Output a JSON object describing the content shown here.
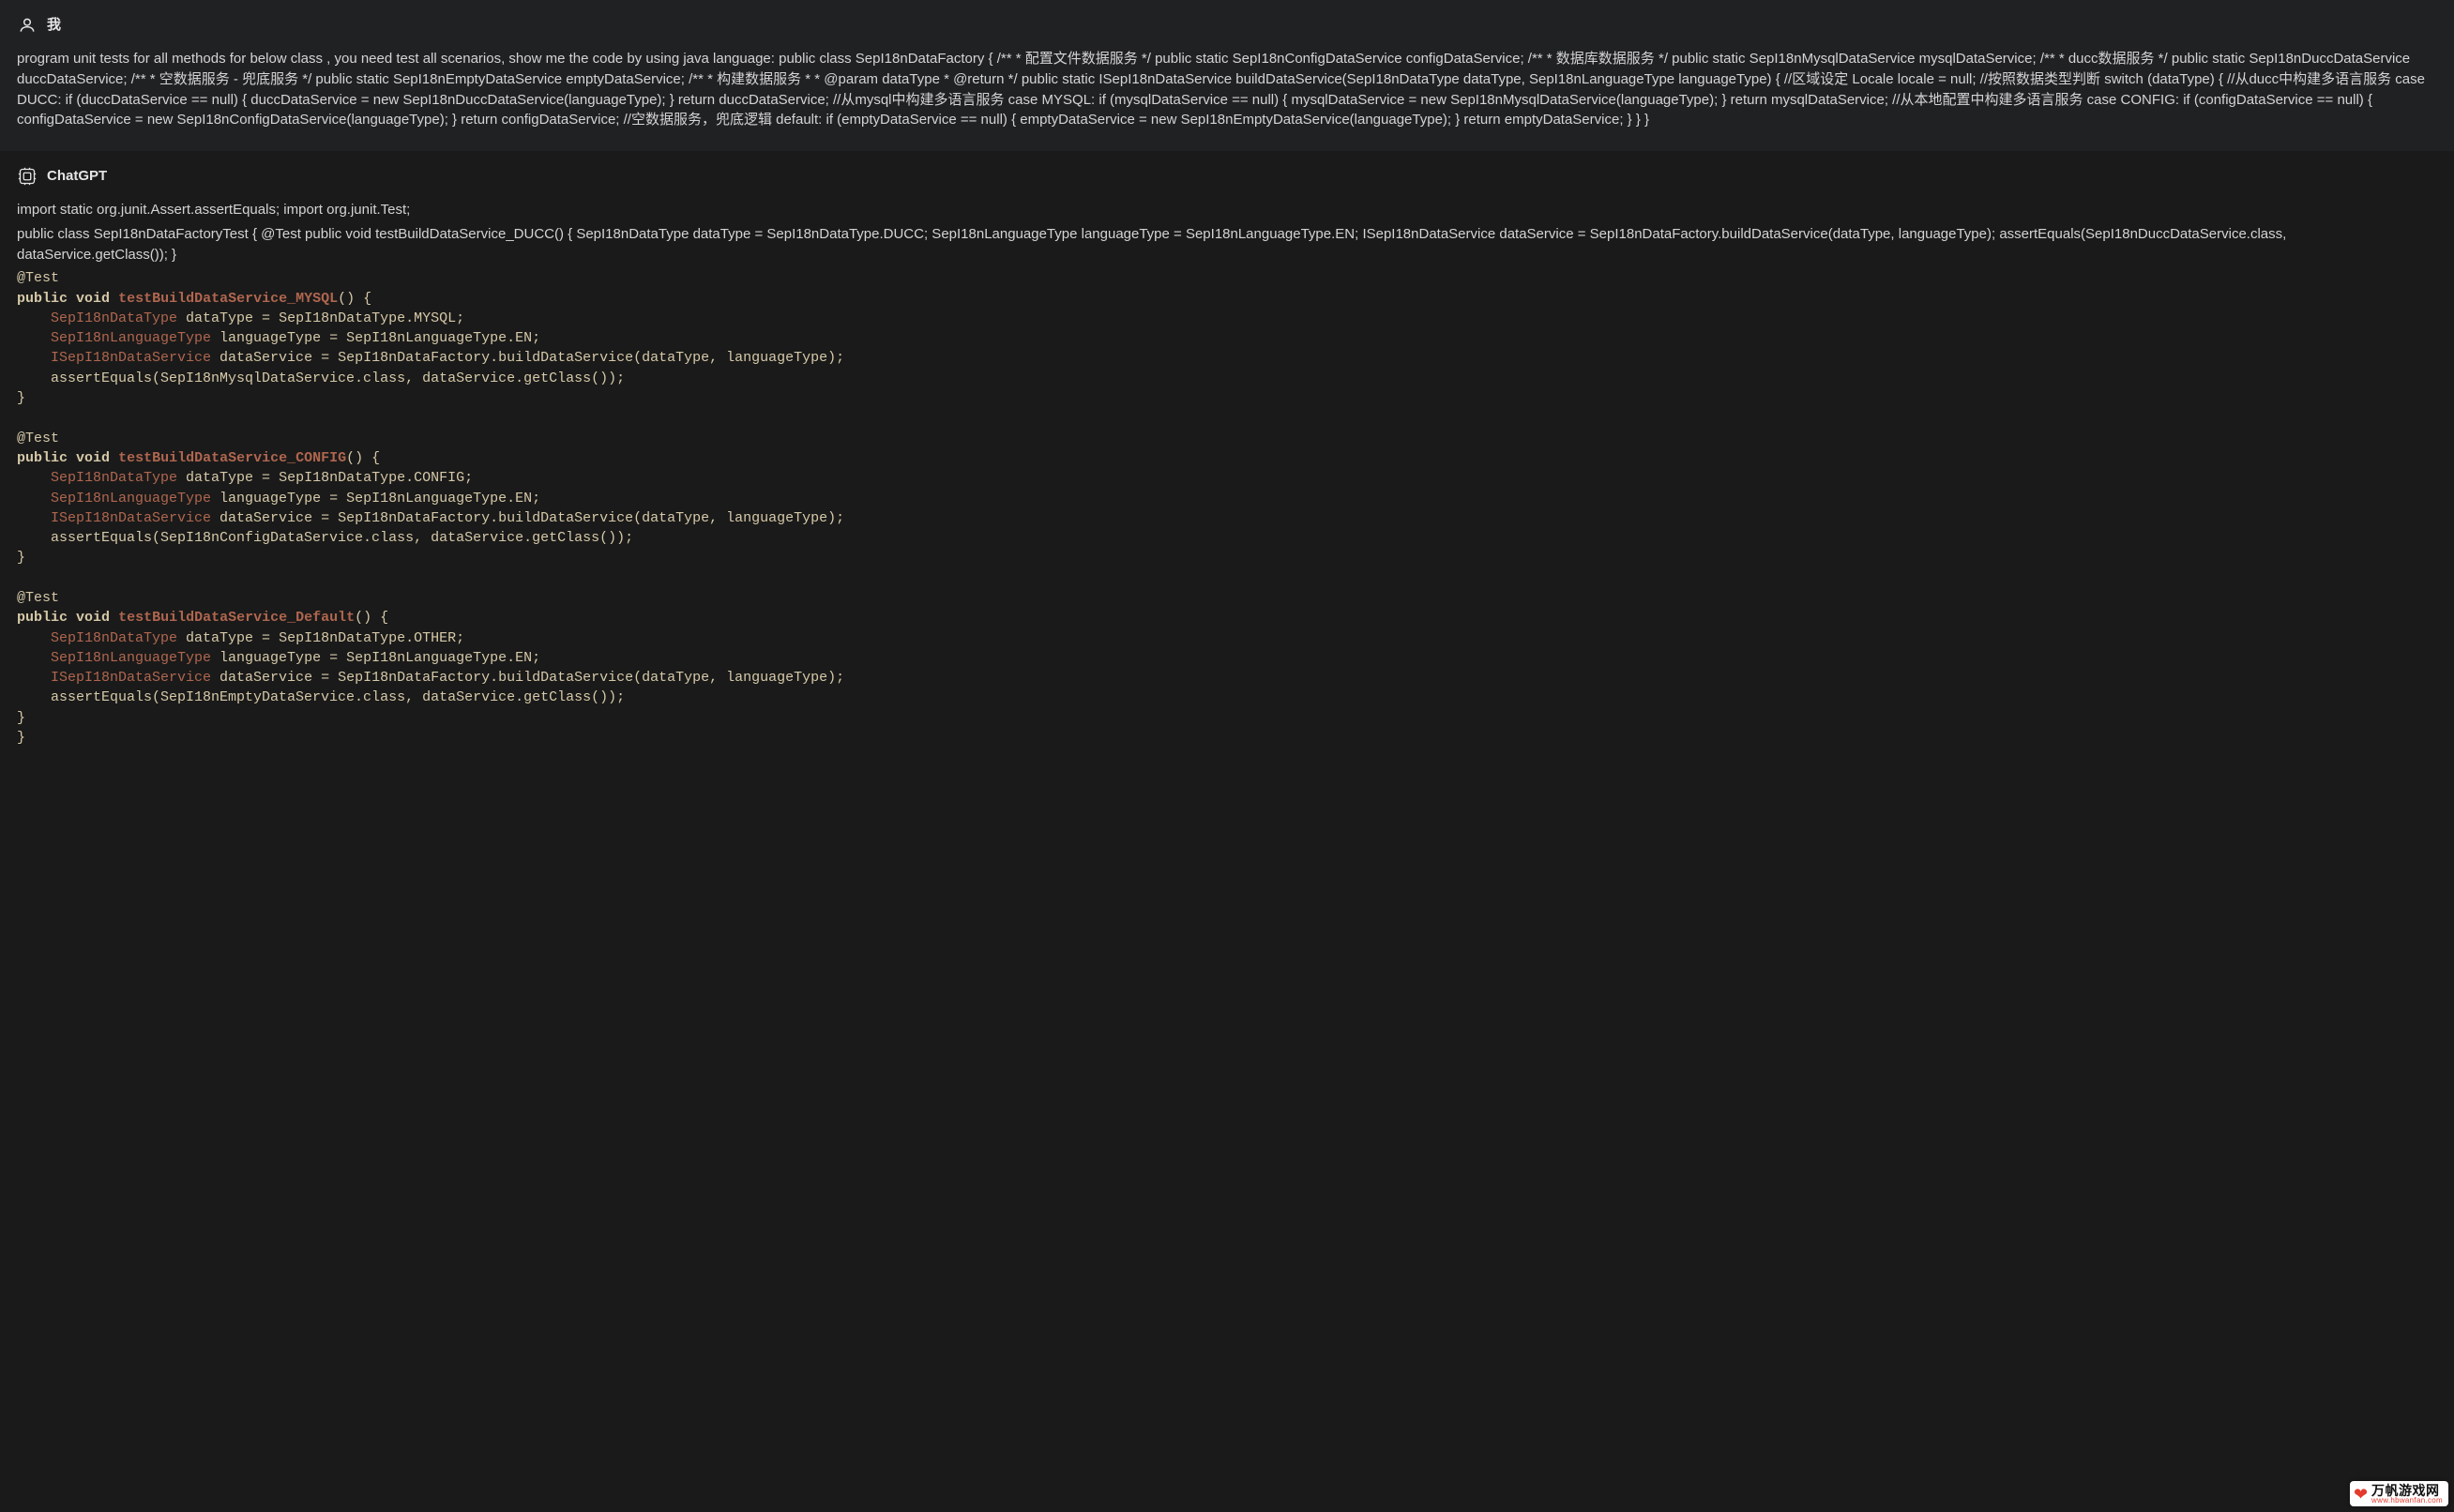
{
  "user": {
    "name": "我",
    "message": "program unit tests for all methods for below class , you need test all scenarios, show me the code by using java language: public class SepI18nDataFactory { /** * 配置文件数据服务 */ public static SepI18nConfigDataService configDataService; /** * 数据库数据服务 */ public static SepI18nMysqlDataService mysqlDataService; /** * ducc数据服务 */ public static SepI18nDuccDataService duccDataService; /** * 空数据服务 - 兜底服务 */ public static SepI18nEmptyDataService emptyDataService; /** * 构建数据服务 * * @param dataType * @return */ public static ISepI18nDataService buildDataService(SepI18nDataType dataType, SepI18nLanguageType languageType) { //区域设定 Locale locale = null; //按照数据类型判断 switch (dataType) { //从ducc中构建多语言服务 case DUCC: if (duccDataService == null) { duccDataService = new SepI18nDuccDataService(languageType); } return duccDataService; //从mysql中构建多语言服务 case MYSQL: if (mysqlDataService == null) { mysqlDataService = new SepI18nMysqlDataService(languageType); } return mysqlDataService; //从本地配置中构建多语言服务 case CONFIG: if (configDataService == null) { configDataService = new SepI18nConfigDataService(languageType); } return configDataService; //空数据服务，兜底逻辑 default: if (emptyDataService == null) { emptyDataService = new SepI18nEmptyDataService(languageType); } return emptyDataService; } } }"
  },
  "assistant": {
    "name": "ChatGPT",
    "intro_line1": "import static org.junit.Assert.assertEquals; import org.junit.Test;",
    "intro_line2": "public class SepI18nDataFactoryTest { @Test public void testBuildDataService_DUCC() { SepI18nDataType dataType = SepI18nDataType.DUCC; SepI18nLanguageType languageType = SepI18nLanguageType.EN; ISepI18nDataService dataService = SepI18nDataFactory.buildDataService(dataType, languageType); assertEquals(SepI18nDuccDataService.class, dataService.getClass()); }",
    "code": {
      "annotation": "@Test",
      "kw_public": "public",
      "kw_void": "void",
      "type_dt": "SepI18nDataType",
      "type_lang": "SepI18nLanguageType",
      "type_iservice": "ISepI18nDataService",
      "blocks": [
        {
          "fn": "testBuildDataService_MYSQL",
          "dt_assign": " dataType = SepI18nDataType.MYSQL;",
          "lang_assign": " languageType = SepI18nLanguageType.EN;",
          "svc_assign": " dataService = SepI18nDataFactory.buildDataService(dataType, languageType);",
          "assert_line": "    assertEquals(SepI18nMysqlDataService.class, dataService.getClass());"
        },
        {
          "fn": "testBuildDataService_CONFIG",
          "dt_assign": " dataType = SepI18nDataType.CONFIG;",
          "lang_assign": " languageType = SepI18nLanguageType.EN;",
          "svc_assign": " dataService = SepI18nDataFactory.buildDataService(dataType, languageType);",
          "assert_line": "    assertEquals(SepI18nConfigDataService.class, dataService.getClass());"
        },
        {
          "fn": "testBuildDataService_Default",
          "dt_assign": " dataType = SepI18nDataType.OTHER;",
          "lang_assign": " languageType = SepI18nLanguageType.EN;",
          "svc_assign": " dataService = SepI18nDataFactory.buildDataService(dataType, languageType);",
          "assert_line": "    assertEquals(SepI18nEmptyDataService.class, dataService.getClass());"
        }
      ],
      "sig_open": "() {",
      "close_brace": "}",
      "final_close": "}"
    }
  },
  "watermark": {
    "top": "万帆游戏网",
    "bottom": "www.hbwanfan.com"
  }
}
